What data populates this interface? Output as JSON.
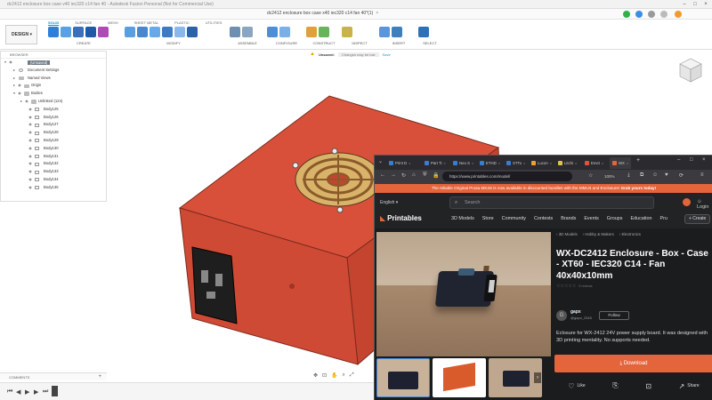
{
  "fusion": {
    "window_title": "dc2412 enclosure box case v40 iec320 c14 fan 40 - Autodesk Fusion Personal (Not for Commercial Use)",
    "doc_tab": "dc2412 enclosure box case x40 iec320 c14 fan 40*(1)",
    "design_label": "DESIGN",
    "tabs": [
      "SOLID",
      "SURFACE",
      "MESH",
      "SHEET METAL",
      "PLASTIC",
      "UTILITIES"
    ],
    "groups": [
      "CREATE",
      "MODIFY",
      "ASSEMBLE",
      "CONFIGURE",
      "CONSTRUCT",
      "INSPECT",
      "INSERT",
      "SELECT"
    ],
    "unsaved": {
      "label": "Unsaved:",
      "message": "Changes may be lost",
      "save": "Save"
    },
    "browser_header": "BROWSER",
    "tree": {
      "root": "(Unsaved)",
      "document_settings": "Document Settings",
      "named_views": "Named Views",
      "origin": "Origin",
      "bodies": "Bodies",
      "unlinked": "Unlinked (124)",
      "body_items": [
        "Body125",
        "Body126",
        "Body127",
        "Body128",
        "Body129",
        "Body130",
        "Body131",
        "Body132",
        "Body133",
        "Body134",
        "Body135"
      ]
    },
    "comments_label": "COMMENTS"
  },
  "browser": {
    "tabs": [
      "Print D",
      "Part Ti",
      "Neo S",
      "ETHD",
      "STTo",
      "Lucon",
      "Litchi",
      "EnvIt",
      "WX"
    ],
    "url": "https://www.printables.com/model/",
    "zoom": "100%",
    "promo_text": "The reliable Original Prusa MK4S is now available in discounted bundles with the MMU3 and Enclosure!",
    "promo_cta": "Grab yours today!",
    "lang": "English",
    "search_placeholder": "Search",
    "login": "Login",
    "logo": "Printables",
    "nav": [
      "3D Models",
      "Store",
      "Community",
      "Contests",
      "Brands",
      "Events",
      "Groups",
      "Education",
      "Pru"
    ],
    "create": "+ Create",
    "breadcrumbs": [
      "3D Models",
      "Hobby & Makers",
      "Electronics"
    ],
    "title": "WX-DC2412 Enclosure - Box - Case - XT60 - IEC320 C14 - Fan 40x40x10mm",
    "rating_count": "0 reviews",
    "author": "gapx",
    "author_handle": "@gapx_2345",
    "follow": "Follow",
    "description": "Eclosure for WX-2412 24V power supply board. It was designed with 3D printing mentality. No supports needed.",
    "download": "Download",
    "actions": [
      "Like",
      "",
      "",
      "Share"
    ]
  },
  "colors": {
    "fusion_accent": "#0696d7",
    "model_red": "#d64b33",
    "printables_orange": "#e4643c",
    "browser_dark": "#1e1f22"
  }
}
